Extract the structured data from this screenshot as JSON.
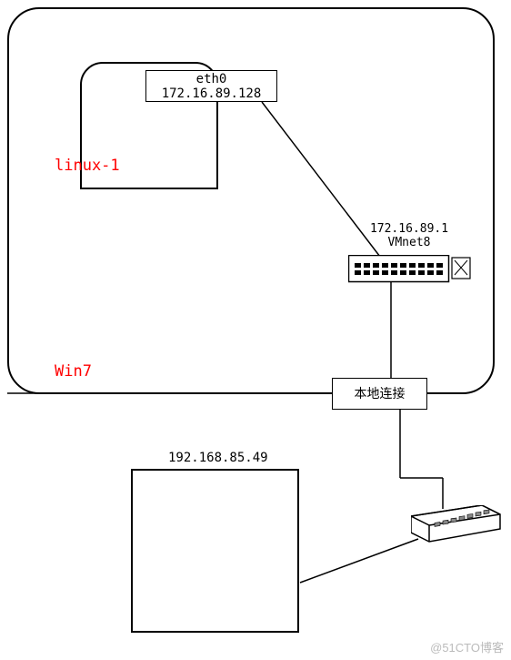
{
  "linux_box": {
    "label": "linux-1",
    "interface": {
      "name": "eth0",
      "ip": "172.16.89.128"
    }
  },
  "win7_box": {
    "label": "Win7",
    "local_connection_label": "本地连接"
  },
  "vmnet_switch": {
    "ip": "172.16.89.1",
    "name": "VMnet8"
  },
  "bottom_host": {
    "ip": "192.168.85.49"
  },
  "watermark": "@51CTO博客"
}
